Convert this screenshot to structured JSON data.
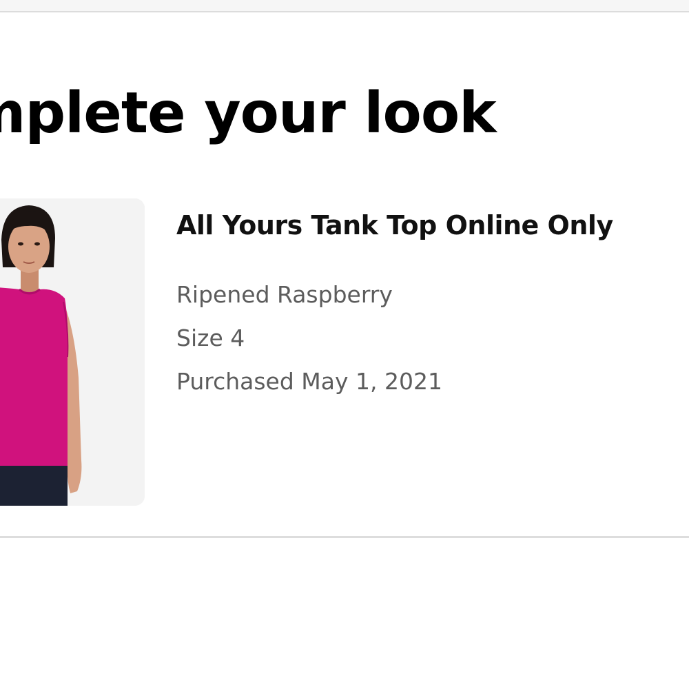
{
  "section": {
    "title": "mplete your look"
  },
  "product": {
    "name": "All Yours Tank Top Online Only",
    "color": "Ripened Raspberry",
    "size": "Size 4",
    "purchased": "Purchased May 1, 2021",
    "image_icon": "product-photo-tank-top",
    "swatch_color": "#d0127d"
  }
}
